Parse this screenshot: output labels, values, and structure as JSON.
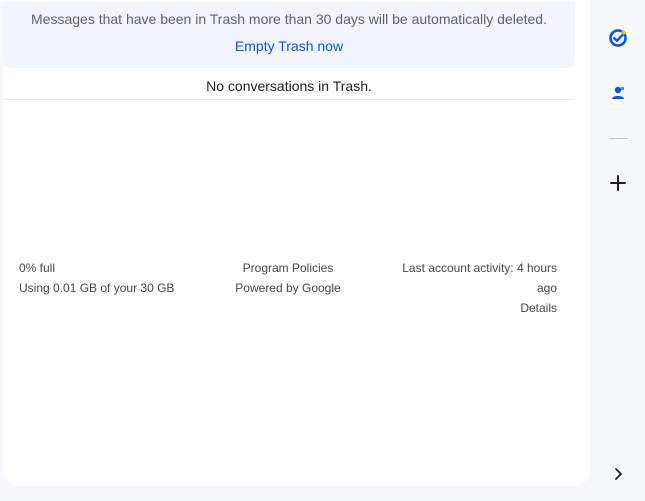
{
  "trash_banner": {
    "message": "Messages that have been in Trash more than 30 days will be automatically deleted.",
    "empty_trash_label": "Empty Trash now"
  },
  "conversation_list": {
    "empty_message": "No conversations in Trash."
  },
  "footer": {
    "storage_percent": "0% full",
    "storage_usage": "Using 0.01 GB of your 30 GB",
    "program_policies": "Program Policies",
    "powered_by": "Powered by Google",
    "last_activity": "Last account activity: 4 hours ago",
    "details_label": "Details"
  },
  "side_panel": {
    "icons": [
      "tasks-icon",
      "contacts-icon",
      "add-icon",
      "chevron-right-icon"
    ],
    "accent_color": "#0b57d0"
  }
}
